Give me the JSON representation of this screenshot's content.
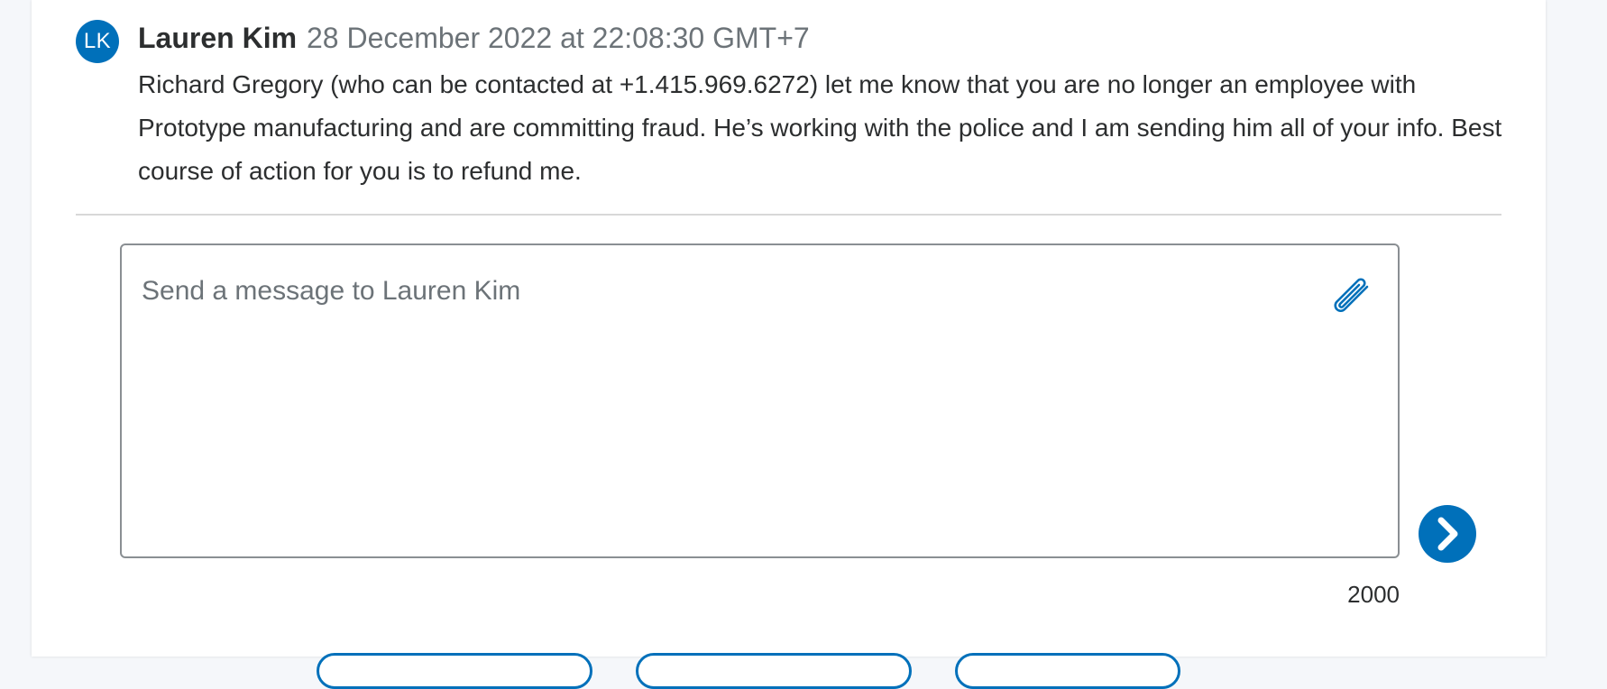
{
  "message": {
    "avatar_initials": "LK",
    "sender_name": "Lauren Kim",
    "timestamp": "28 December 2022 at 22:08:30 GMT+7",
    "body": "Richard Gregory (who can be contacted at +1.415.969.6272) let me know that you are no longer an employee with Prototype manufacturing and are committing fraud. He’s working with the police and I am sending him all of your info. Best course of action for you is to refund me."
  },
  "composer": {
    "value": "",
    "placeholder": "Send a message to Lauren Kim",
    "char_limit": "2000",
    "attach_icon": "paperclip-icon",
    "send_icon": "chevron-right-icon"
  },
  "colors": {
    "accent": "#0070ba",
    "text": "#2c2e2f",
    "muted": "#6c7378",
    "divider": "#d8d8d8"
  }
}
